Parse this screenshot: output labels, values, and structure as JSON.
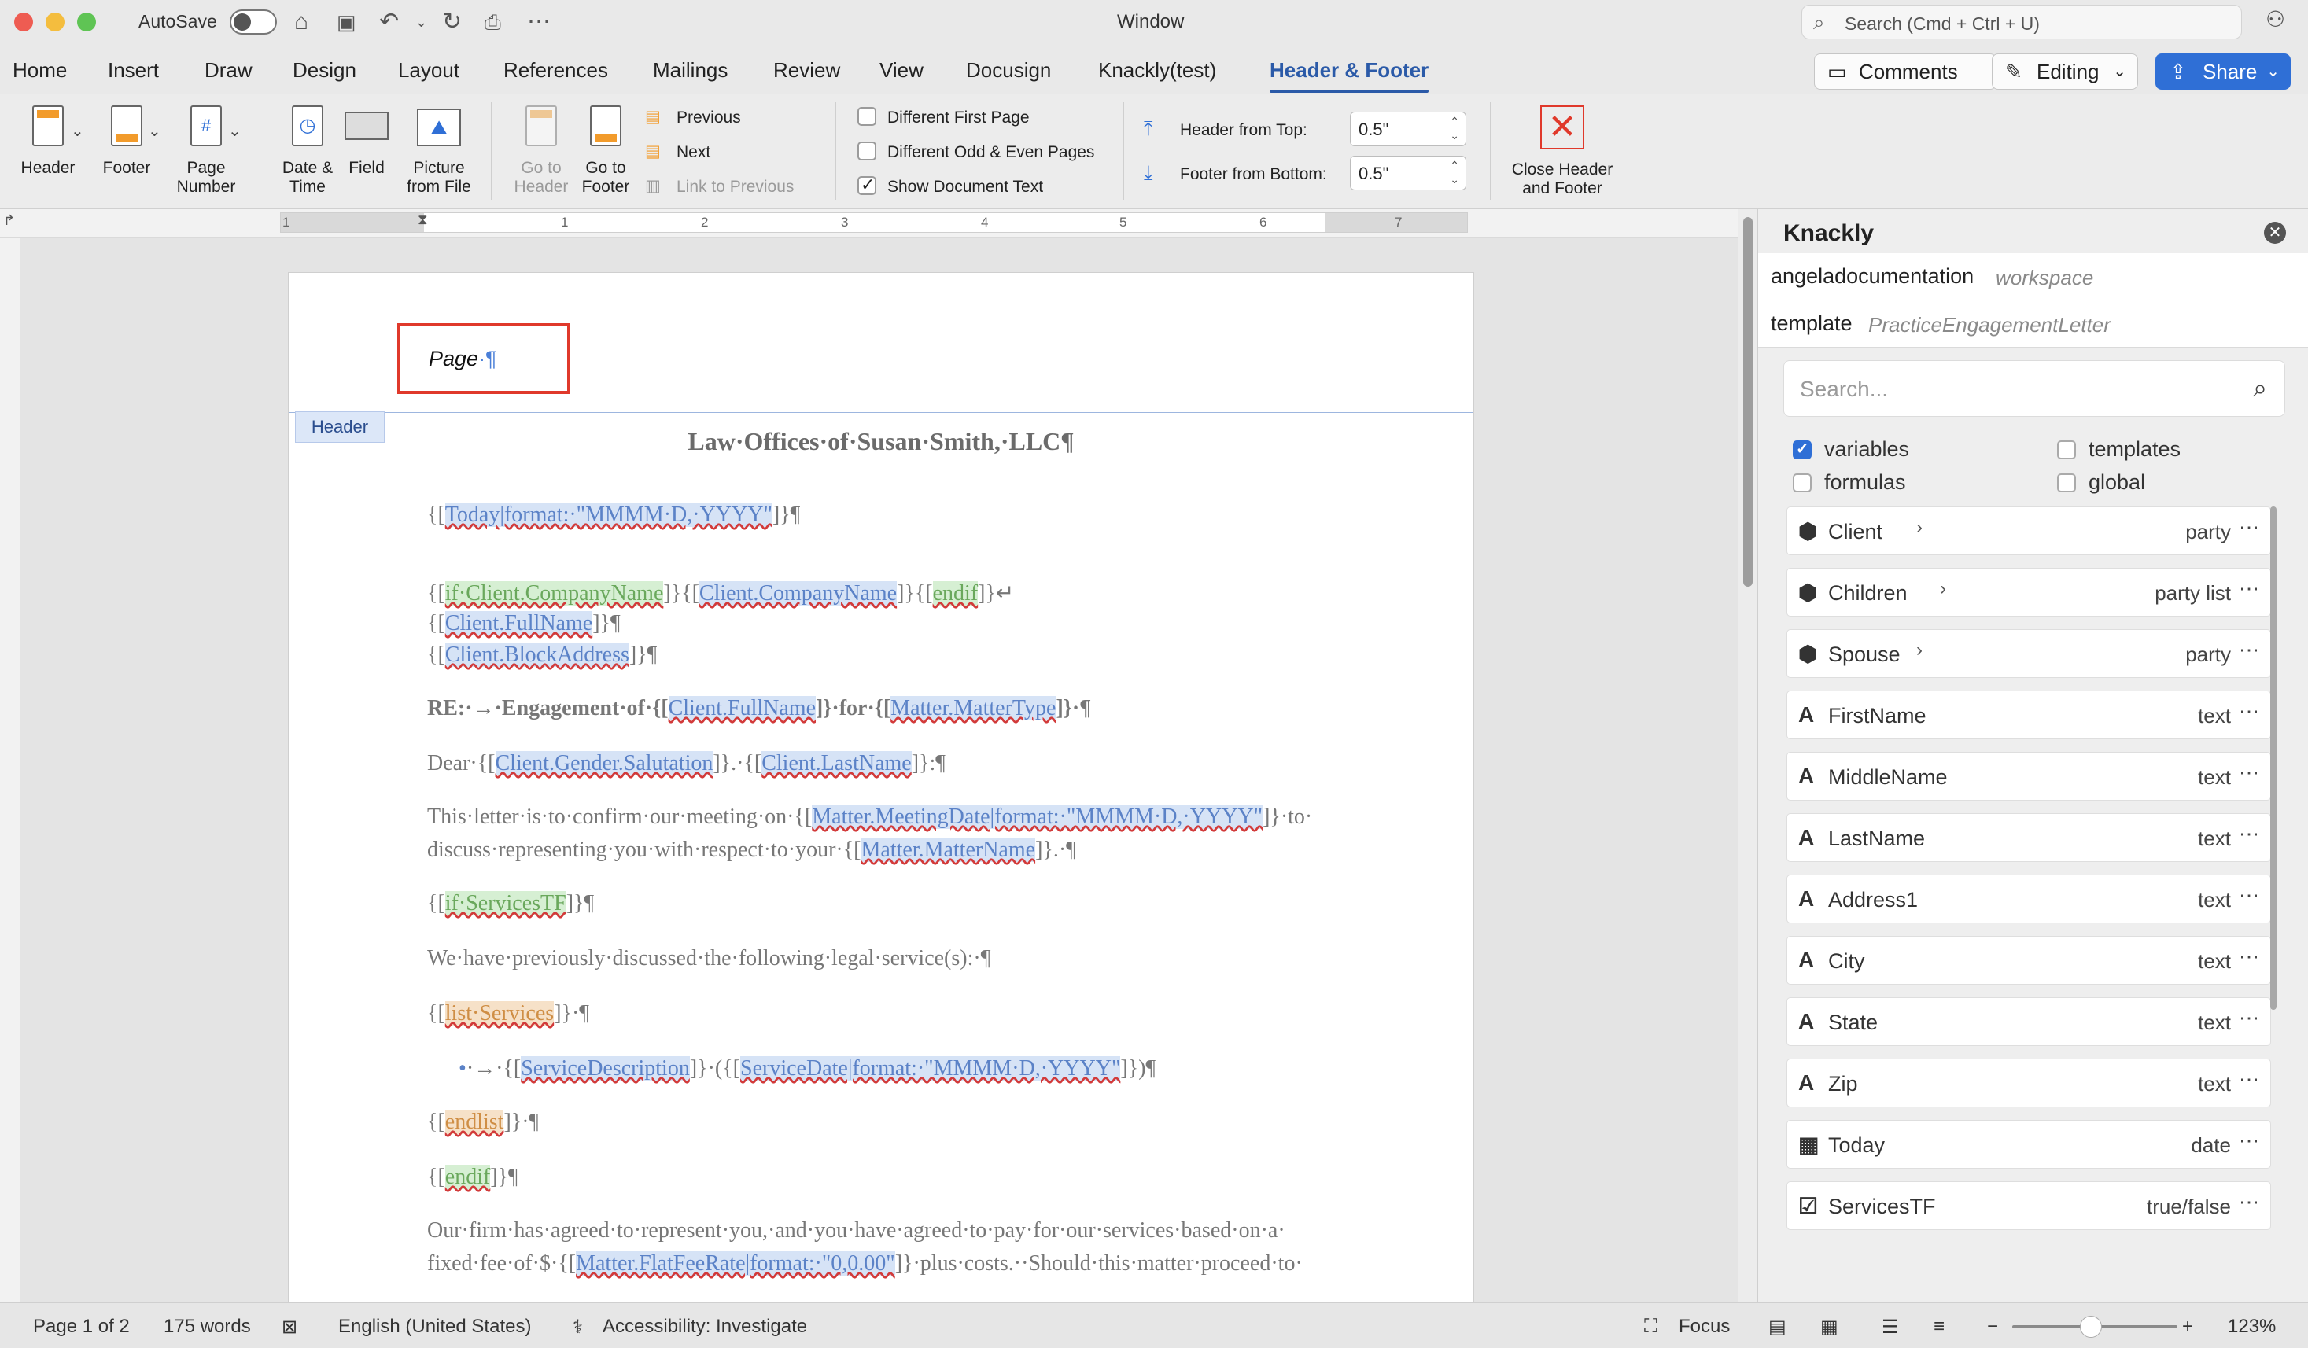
{
  "titlebar": {
    "autosave_label": "AutoSave",
    "window_title": "Window",
    "search_placeholder": "Search (Cmd + Ctrl + U)"
  },
  "menu": {
    "tabs": [
      "Home",
      "Insert",
      "Draw",
      "Design",
      "Layout",
      "References",
      "Mailings",
      "Review",
      "View",
      "Docusign",
      "Knackly(test)",
      "Header & Footer"
    ],
    "active_tab": "Header & Footer",
    "comments_label": "Comments",
    "editing_label": "Editing",
    "share_label": "Share"
  },
  "ribbon": {
    "header": "Header",
    "footer": "Footer",
    "page_number": [
      "Page",
      "Number"
    ],
    "date_time": [
      "Date &",
      "Time"
    ],
    "field": "Field",
    "picture": [
      "Picture",
      "from File"
    ],
    "go_to_header": [
      "Go to",
      "Header"
    ],
    "go_to_footer": [
      "Go to",
      "Footer"
    ],
    "previous": "Previous",
    "next": "Next",
    "link_to_previous": "Link to Previous",
    "different_first_page": "Different First Page",
    "different_odd_even": "Different Odd & Even Pages",
    "show_document_text": "Show Document Text",
    "header_from_top_label": "Header from Top:",
    "header_from_top_value": "0.5\"",
    "footer_from_bottom_label": "Footer from Bottom:",
    "footer_from_bottom_value": "0.5\"",
    "close": [
      "Close Header",
      "and Footer"
    ]
  },
  "ruler": {
    "numbers": [
      "1",
      "1",
      "2",
      "3",
      "4",
      "5",
      "6",
      "7"
    ]
  },
  "document": {
    "header_text": "Page",
    "header_tag": "Header",
    "title": "Law·Offices·of·Susan·Smith,·LLC¶"
  },
  "panel": {
    "title": "Knackly",
    "workspace_key": "angeladocumentation",
    "workspace_val": "workspace",
    "template_key": "template",
    "template_val": "PracticeEngagementLetter",
    "search_placeholder": "Search...",
    "filters": {
      "variables": "variables",
      "templates": "templates",
      "formulas": "formulas",
      "global": "global"
    },
    "items": [
      {
        "name": "Client",
        "type": "party",
        "icon": "cube-icon"
      },
      {
        "name": "Children",
        "type": "party list",
        "icon": "cube-icon"
      },
      {
        "name": "Spouse",
        "type": "party",
        "icon": "cube-icon"
      },
      {
        "name": "FirstName",
        "type": "text",
        "icon": "text-icon"
      },
      {
        "name": "MiddleName",
        "type": "text",
        "icon": "text-icon"
      },
      {
        "name": "LastName",
        "type": "text",
        "icon": "text-icon"
      },
      {
        "name": "Address1",
        "type": "text",
        "icon": "text-icon"
      },
      {
        "name": "City",
        "type": "text",
        "icon": "text-icon"
      },
      {
        "name": "State",
        "type": "text",
        "icon": "text-icon"
      },
      {
        "name": "Zip",
        "type": "text",
        "icon": "text-icon"
      },
      {
        "name": "Today",
        "type": "date",
        "icon": "calendar-icon"
      },
      {
        "name": "ServicesTF",
        "type": "true/false",
        "icon": "checkbox-icon"
      }
    ]
  },
  "status": {
    "page": "Page 1 of 2",
    "words": "175 words",
    "language": "English (United States)",
    "accessibility": "Accessibility: Investigate",
    "focus": "Focus",
    "zoom": "123%"
  }
}
